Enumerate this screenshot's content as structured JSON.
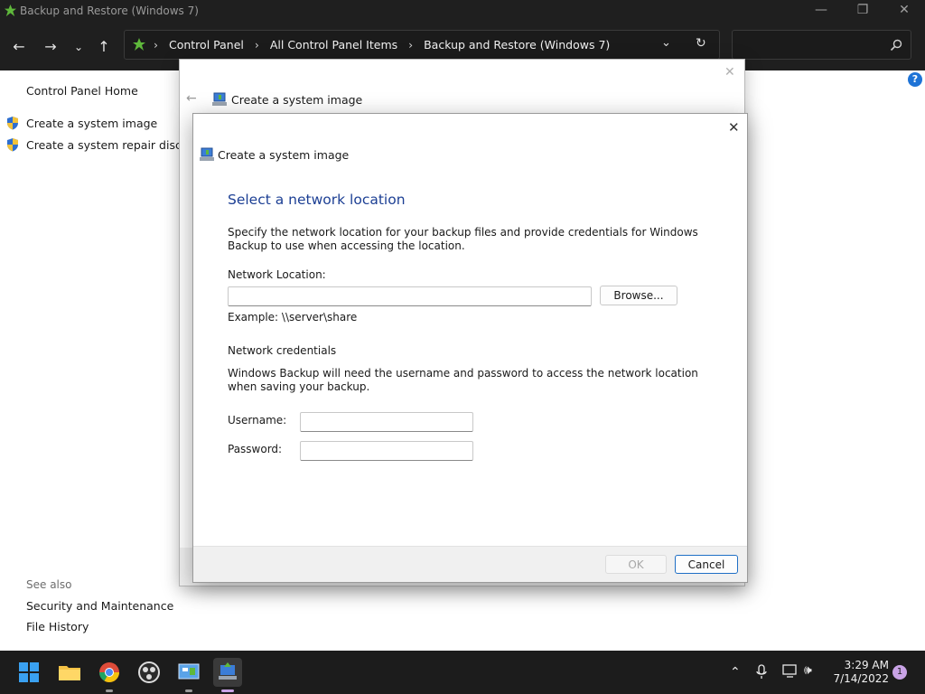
{
  "window": {
    "title": "Backup and Restore (Windows 7)"
  },
  "address": {
    "crumbs": [
      "Control Panel",
      "All Control Panel Items",
      "Backup and Restore (Windows 7)"
    ]
  },
  "sidebar": {
    "home": "Control Panel Home",
    "tasks": [
      "Create a system image",
      "Create a system repair disc"
    ],
    "see_also_label": "See also",
    "see_also": [
      "Security and Maintenance",
      "File History"
    ]
  },
  "dialog_back": {
    "title": "Create a system image"
  },
  "dialog": {
    "title": "Create a system image",
    "heading": "Select a network location",
    "description": "Specify the network location for your backup files and provide credentials for Windows Backup to use when accessing the location.",
    "network_location_label": "Network Location:",
    "network_location_value": "",
    "browse_label": "Browse...",
    "example": "Example: \\\\server\\share",
    "credentials_heading": "Network credentials",
    "credentials_desc": "Windows Backup will need the username and password to access the network location when saving your backup.",
    "username_label": "Username:",
    "username_value": "",
    "password_label": "Password:",
    "password_value": "",
    "ok_label": "OK",
    "cancel_label": "Cancel"
  },
  "taskbar": {
    "time": "3:29 AM",
    "date": "7/14/2022",
    "notification_count": "1"
  },
  "colors": {
    "heading": "#1c3f94",
    "accent": "#1f6fc5",
    "titlebar": "#1f1f1f",
    "taskbar": "#1c1c1c"
  }
}
